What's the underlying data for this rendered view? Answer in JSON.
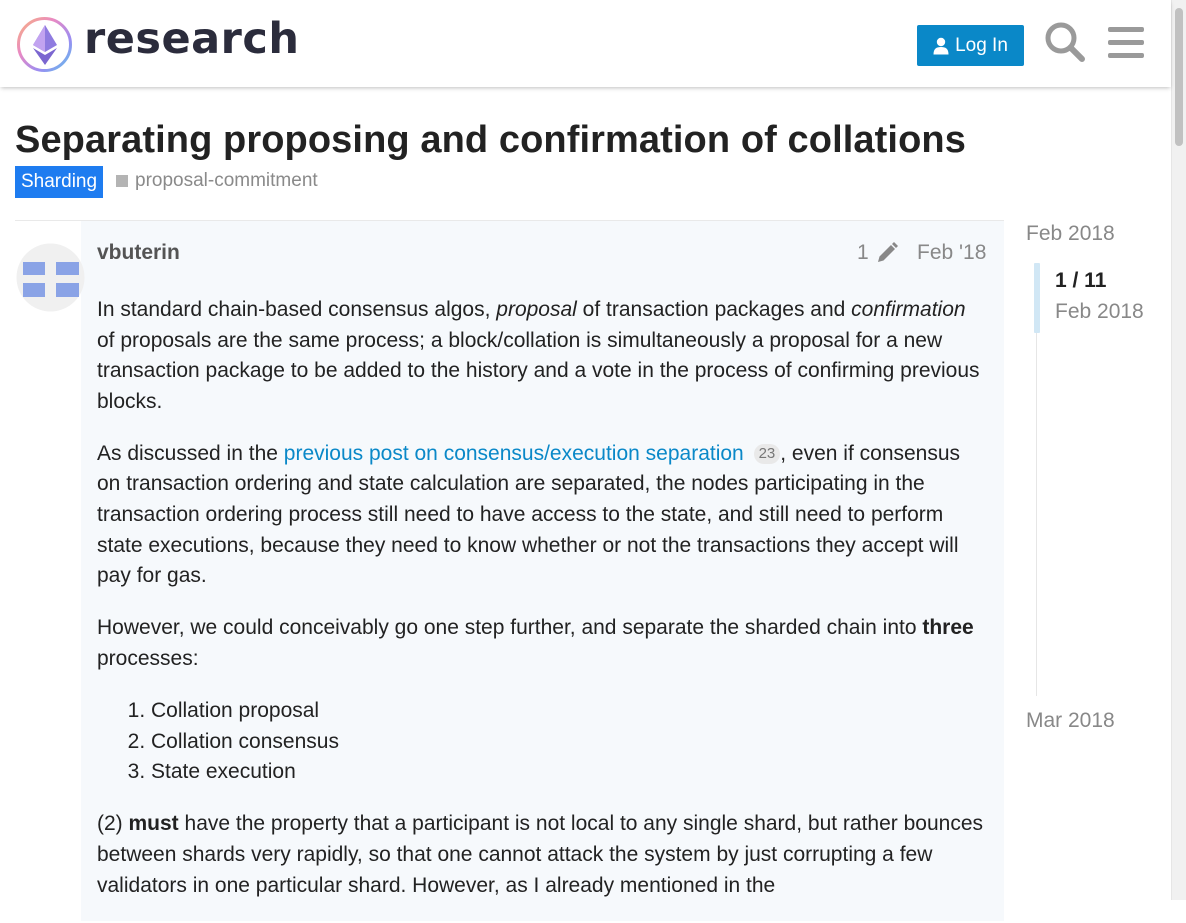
{
  "header": {
    "brand": "research",
    "login_label": "Log In"
  },
  "topic": {
    "title": "Separating proposing and confirmation of collations",
    "category": "Sharding",
    "tag": "proposal-commitment"
  },
  "post": {
    "username": "vbuterin",
    "edit_count": "1",
    "date": "Feb '18",
    "p1": {
      "a": "In standard chain-based consensus algos, ",
      "em1": "proposal",
      "b": " of transaction packages and ",
      "em2": "confirmation",
      "c": " of proposals are the same process; a block/collation is simultaneously a proposal for a new transaction package to be added to the history and a vote in the process of confirming previous blocks."
    },
    "p2": {
      "a": "As discussed in the ",
      "link": "previous post on consensus/execution separation",
      "clicks": "23",
      "b": ", even if consensus on transaction ordering and state calculation are separated, the nodes participating in the transaction ordering process still need to have access to the state, and still need to perform state executions, because they need to know whether or not the transactions they accept will pay for gas."
    },
    "p3": {
      "a": "However, we could conceivably go one step further, and separate the sharded chain into ",
      "strong": "three",
      "b": " processes:"
    },
    "list": [
      "Collation proposal",
      "Collation consensus",
      "State execution"
    ],
    "p4": {
      "a": "(2) ",
      "strong": "must",
      "b": " have the property that a participant is not local to any single shard, but rather bounces between shards very rapidly, so that one cannot attack the system by just corrupting a few validators in one particular shard. However, as I already mentioned in the"
    }
  },
  "timeline": {
    "start": "Feb 2018",
    "position": "1 / 11",
    "position_date": "Feb 2018",
    "end": "Mar 2018"
  },
  "colors": {
    "accent": "#0a88c8",
    "category": "#1e7cf0",
    "post_bg": "#f6f9fc"
  },
  "icons": [
    "logo-icon",
    "user-icon",
    "search-icon",
    "hamburger-menu-icon",
    "pencil-icon",
    "avatar-icon"
  ]
}
